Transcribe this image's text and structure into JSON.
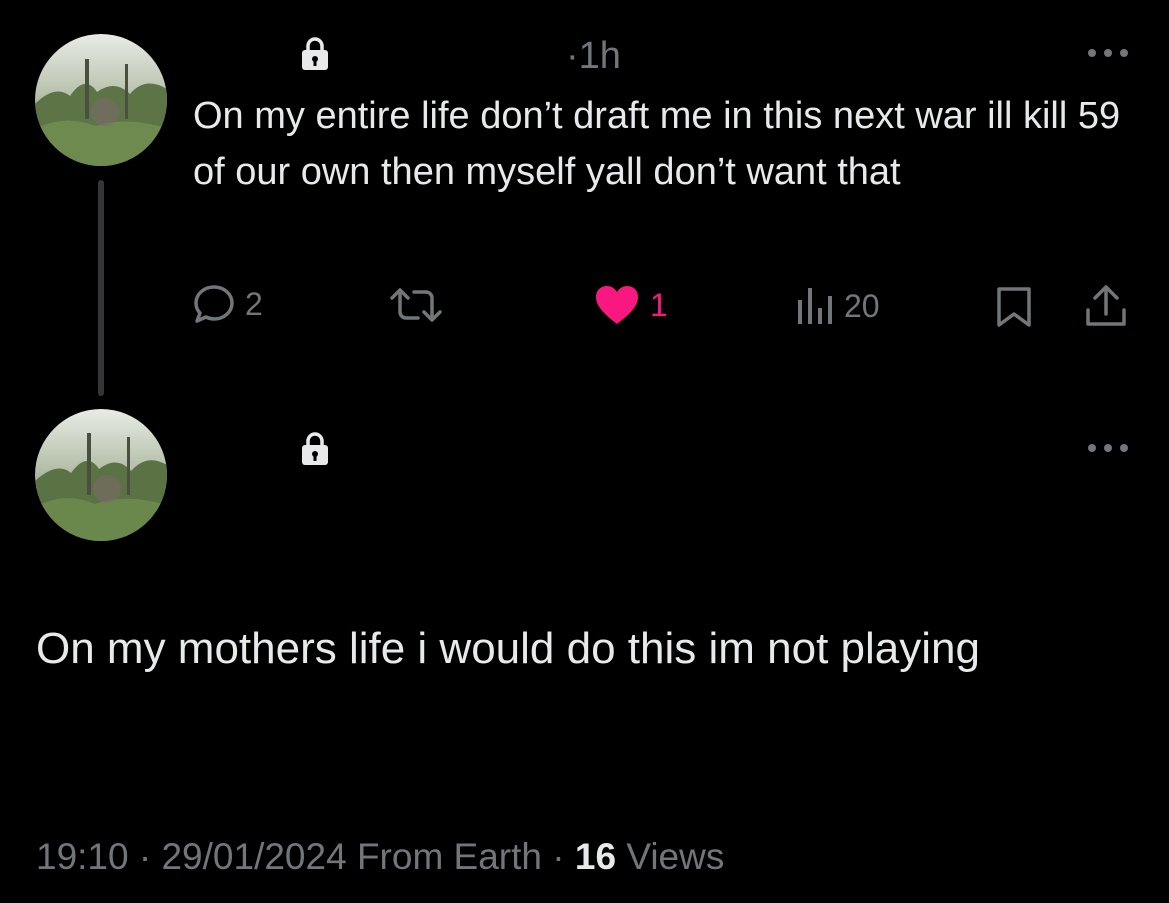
{
  "tweet1": {
    "time": "1h",
    "text": "On my entire life don’t draft me in this next war ill kill 59 of our own then myself yall don’t want that",
    "icons": {
      "avatar": "avatar",
      "lock": "lock-icon",
      "more": "more-icon"
    },
    "actions": {
      "reply_count": "2",
      "retweet_count": "",
      "like_count": "1",
      "views_count": "20"
    }
  },
  "tweet2": {
    "text": "On my mothers life i would do this im not playing",
    "time": "19:10",
    "date": "29/01/2024",
    "source": "From Earth",
    "views_count": "16",
    "views_label": "Views"
  },
  "colors": {
    "background": "#000000",
    "text": "#e7e9ea",
    "muted": "#71767b",
    "like": "#f91880",
    "thread_line": "#333639"
  }
}
